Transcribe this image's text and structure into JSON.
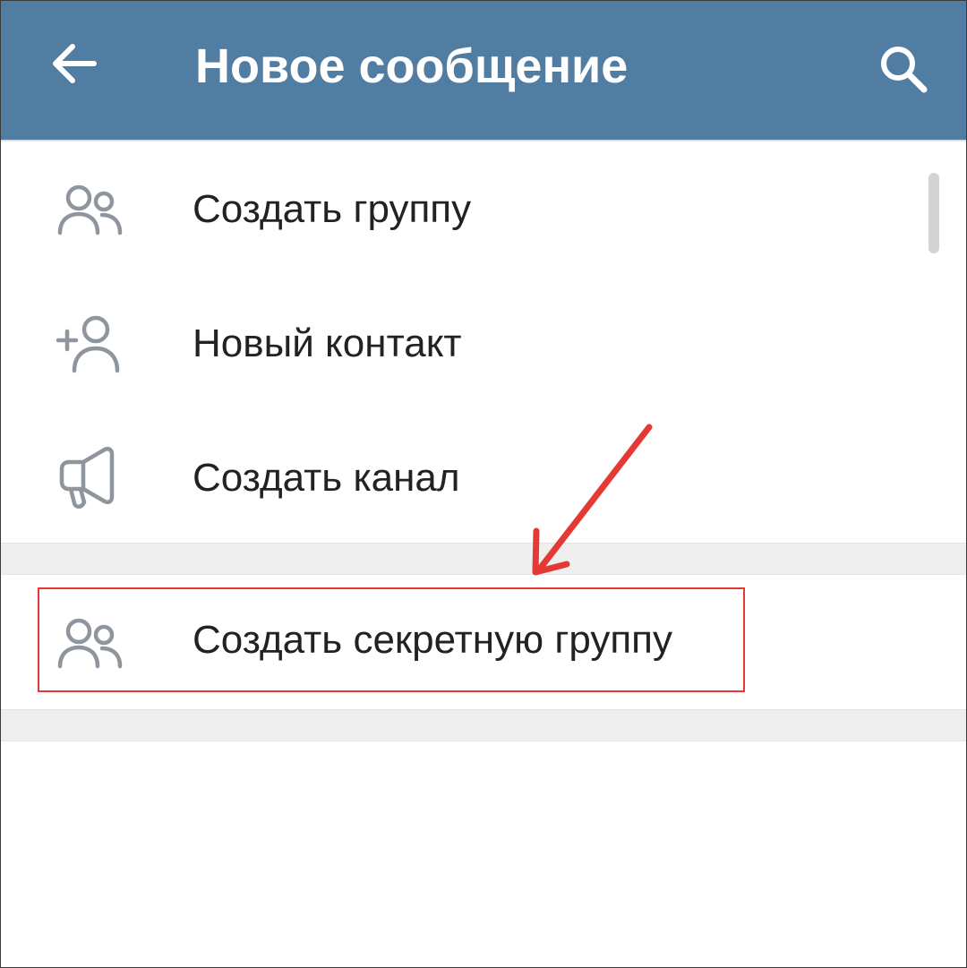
{
  "appbar": {
    "title": "Новое сообщение",
    "back_icon": "arrow-left-icon",
    "search_icon": "search-icon",
    "background_color": "#527da3"
  },
  "menu": {
    "items": [
      {
        "label": "Создать группу",
        "icon": "group-icon"
      },
      {
        "label": "Новый контакт",
        "icon": "add-contact-icon"
      },
      {
        "label": "Создать канал",
        "icon": "megaphone-icon"
      },
      {
        "label": "Создать секретную группу",
        "icon": "group-icon"
      }
    ]
  },
  "annotation": {
    "highlight_color": "#e53935",
    "arrow_icon": "red-arrow-icon"
  }
}
